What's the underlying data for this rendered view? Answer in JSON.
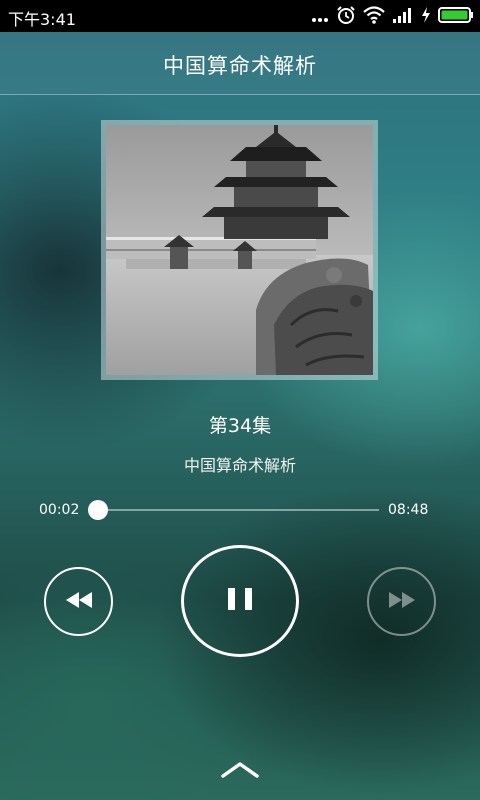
{
  "status_bar": {
    "time": "下午3:41",
    "icons": [
      "more-dots-icon",
      "alarm-icon",
      "wifi-icon",
      "signal-icon",
      "charging-icon",
      "battery-icon"
    ],
    "battery_color": "#33cc33"
  },
  "header": {
    "title": "中国算命术解析"
  },
  "track": {
    "episode": "第34集",
    "album": "中国算命术解析"
  },
  "playback": {
    "current_time": "00:02",
    "total_time": "08:48",
    "progress": 0.004,
    "state": "playing"
  },
  "controls": {
    "prev_icon": "rewind-icon",
    "play_pause_icon": "pause-icon",
    "next_icon": "fast-forward-icon",
    "next_enabled": false,
    "expand_icon": "chevron-up-icon"
  }
}
